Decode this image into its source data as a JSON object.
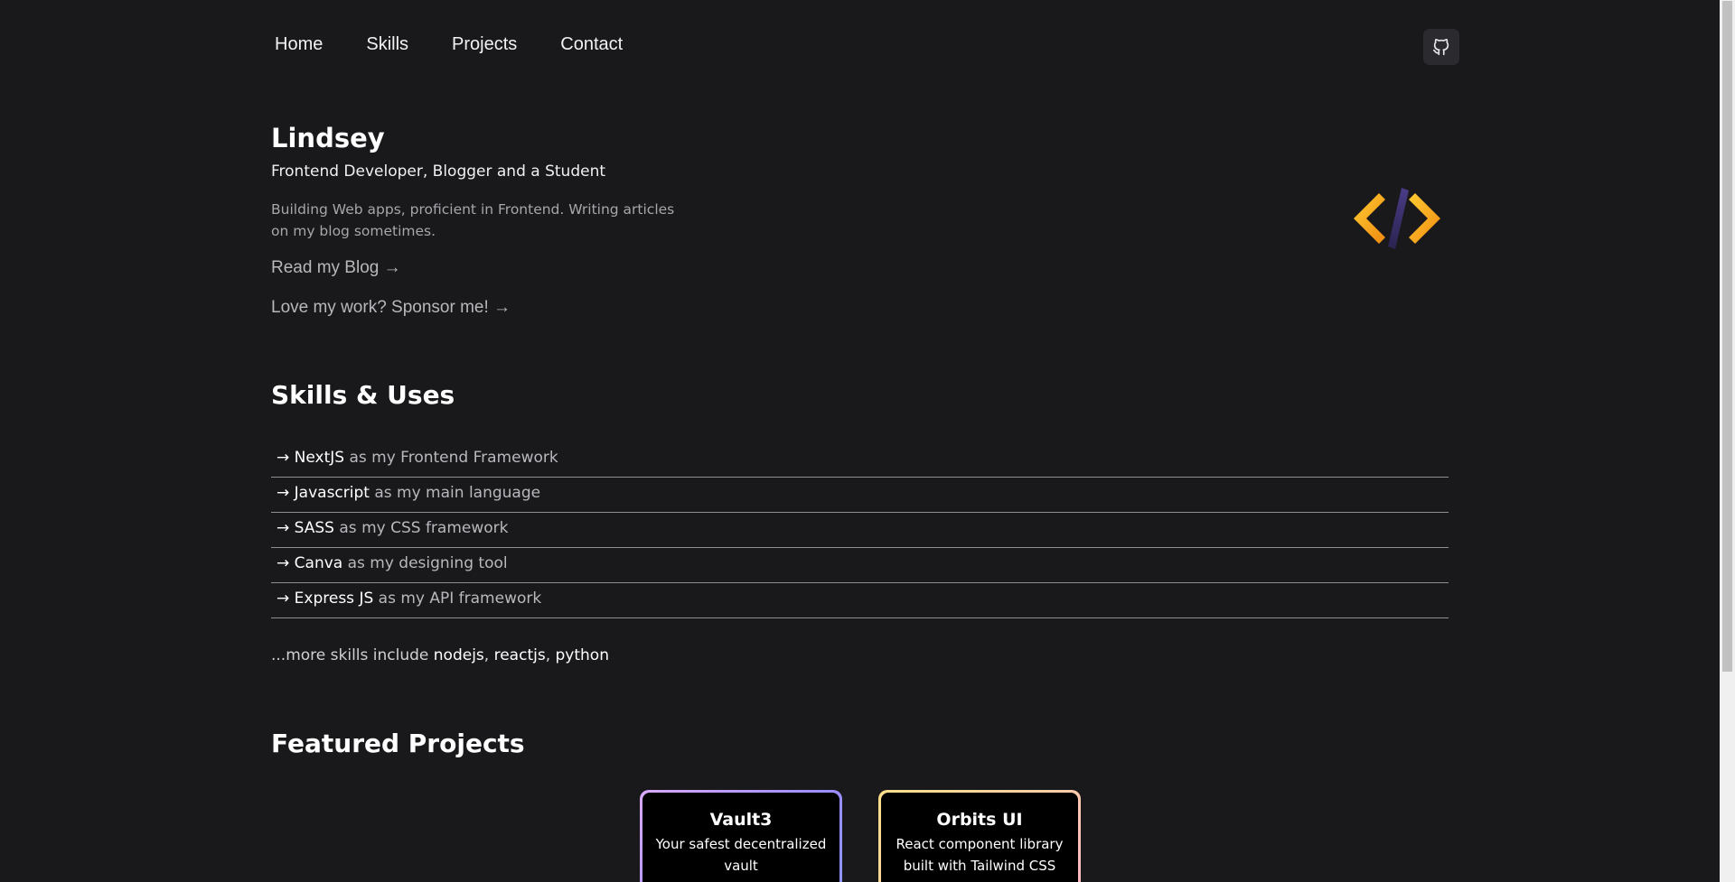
{
  "nav": {
    "items": [
      {
        "label": "Home"
      },
      {
        "label": "Skills"
      },
      {
        "label": "Projects"
      },
      {
        "label": "Contact"
      }
    ],
    "github_icon": "github-icon"
  },
  "hero": {
    "name": "Lindsey",
    "role": "Frontend Developer, Blogger and a Student",
    "description": "Building Web apps, proficient in Frontend. Writing articles on my blog sometimes.",
    "blog_link": "Read my Blog →",
    "sponsor_link": "Love my work? Sponsor me! →",
    "logo_icon": "code-brackets-icon"
  },
  "skills": {
    "title": "Skills & Uses",
    "items": [
      {
        "arrow": "→",
        "name": "NextJS",
        "rest": " as my Frontend Framework"
      },
      {
        "arrow": "→",
        "name": "Javascript",
        "rest": " as my main language"
      },
      {
        "arrow": "→",
        "name": "SASS",
        "rest": " as my CSS framework"
      },
      {
        "arrow": "→",
        "name": "Canva",
        "rest": " as my designing tool"
      },
      {
        "arrow": "→",
        "name": "Express JS",
        "rest": " as my API framework"
      }
    ],
    "more_prefix": "...more skills include ",
    "more": [
      "nodejs",
      "reactjs",
      "python"
    ],
    "more_sep": ", "
  },
  "projects": {
    "title": "Featured Projects",
    "cards": [
      {
        "title": "Vault3",
        "description": "Your safest decentralized vault"
      },
      {
        "title": "Orbits UI",
        "description": "React component library built with Tailwind CSS"
      }
    ]
  },
  "colors": {
    "background": "#19181b",
    "logo_orange": "#f5a623",
    "logo_purple": "#3a2f6b"
  }
}
